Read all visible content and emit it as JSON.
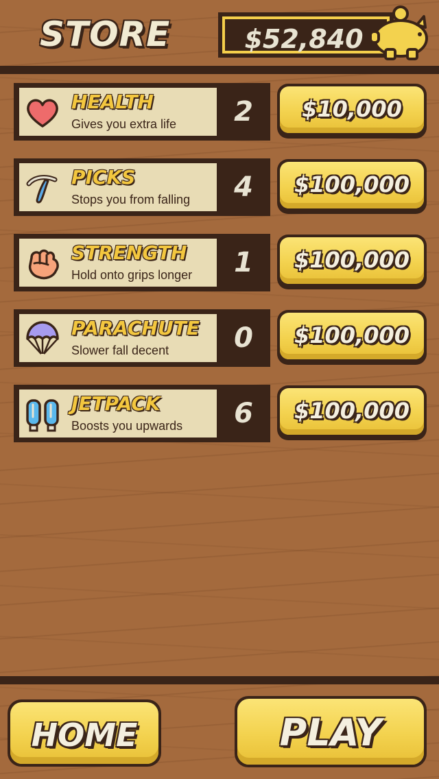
{
  "header": {
    "title": "STORE",
    "balance": "$52,840",
    "balance_icon": "piggy-bank-icon"
  },
  "items": [
    {
      "name": "HEALTH",
      "description": "Gives you extra life",
      "count": "2",
      "price": "$10,000",
      "icon": "heart-icon"
    },
    {
      "name": "PICKS",
      "description": "Stops you from falling",
      "count": "4",
      "price": "$100,000",
      "icon": "pickaxe-icon"
    },
    {
      "name": "STRENGTH",
      "description": "Hold onto grips longer",
      "count": "1",
      "price": "$100,000",
      "icon": "fist-icon"
    },
    {
      "name": "PARACHUTE",
      "description": "Slower fall decent",
      "count": "0",
      "price": "$100,000",
      "icon": "parachute-icon"
    },
    {
      "name": "JETPACK",
      "description": "Boosts you upwards",
      "count": "6",
      "price": "$100,000",
      "icon": "jetpack-icon"
    }
  ],
  "footer": {
    "home_label": "HOME",
    "play_label": "PLAY"
  },
  "colors": {
    "wood": "#a46a3d",
    "dark_brown": "#3a2418",
    "gold": "#f3d24e",
    "card": "#e8dcb5"
  }
}
